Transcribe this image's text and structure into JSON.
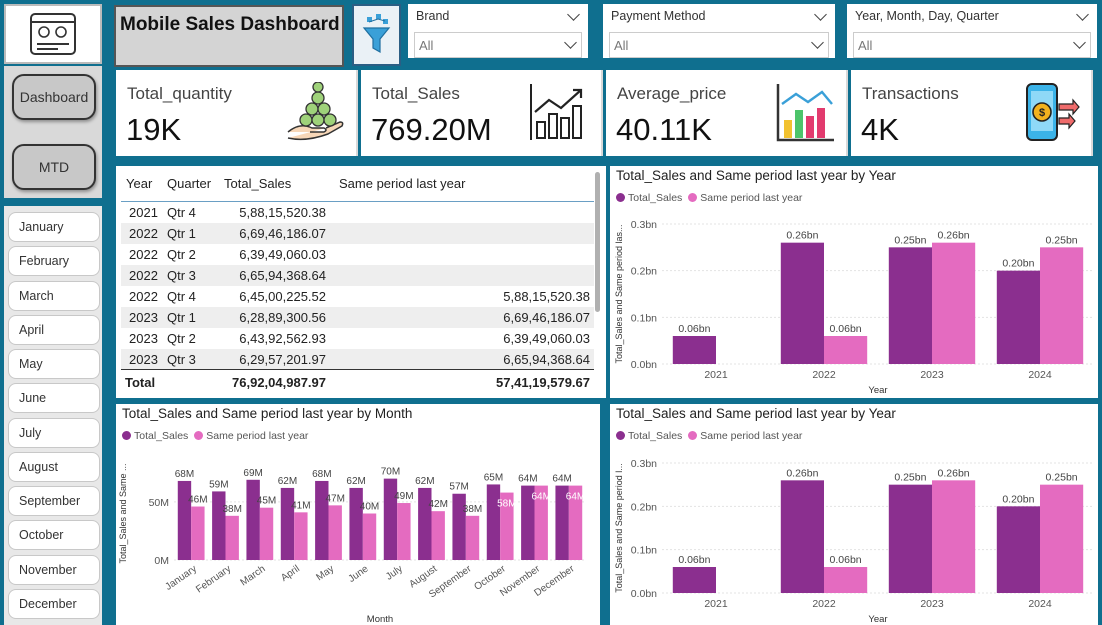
{
  "app": {
    "title": "Mobile Sales Dashboard"
  },
  "nav": {
    "dashboard_label": "Dashboard",
    "mtd_label": "MTD"
  },
  "months": [
    "January",
    "February",
    "March",
    "April",
    "May",
    "June",
    "July",
    "August",
    "September",
    "October",
    "November",
    "December"
  ],
  "filters": {
    "brand": {
      "label": "Brand",
      "value": "All"
    },
    "payment": {
      "label": "Payment Method",
      "value": "All"
    },
    "date": {
      "label": "Year, Month, Day, Quarter",
      "value": "All"
    }
  },
  "kpis": {
    "quantity": {
      "label": "Total_quantity",
      "value": "19K"
    },
    "sales": {
      "label": "Total_Sales",
      "value": "769.20M"
    },
    "avg_price": {
      "label": "Average_price",
      "value": "40.11K"
    },
    "transactions": {
      "label": "Transactions",
      "value": "4K"
    }
  },
  "table": {
    "headers": [
      "Year",
      "Quarter",
      "Total_Sales",
      "Same period last year"
    ],
    "rows": [
      [
        "2021",
        "Qtr 4",
        "5,88,15,520.38",
        ""
      ],
      [
        "2022",
        "Qtr 1",
        "6,69,46,186.07",
        ""
      ],
      [
        "2022",
        "Qtr 2",
        "6,39,49,060.03",
        ""
      ],
      [
        "2022",
        "Qtr 3",
        "6,65,94,368.64",
        ""
      ],
      [
        "2022",
        "Qtr 4",
        "6,45,00,225.52",
        "5,88,15,520.38"
      ],
      [
        "2023",
        "Qtr 1",
        "6,28,89,300.56",
        "6,69,46,186.07"
      ],
      [
        "2023",
        "Qtr 2",
        "6,43,92,562.93",
        "6,39,49,060.03"
      ],
      [
        "2023",
        "Qtr 3",
        "6,29,57,201.97",
        "6,65,94,368.64"
      ]
    ],
    "total": {
      "label": "Total",
      "sales": "76,92,04,987.97",
      "last_year": "57,41,19,579.67"
    }
  },
  "colors": {
    "series1": "#8b2f8f",
    "series2": "#e46bc0",
    "accent": "#0f6f8f"
  },
  "chart_data": [
    {
      "type": "bar",
      "title": "Total_Sales and Same period last year by Year",
      "xlabel": "Year",
      "ylabel": "Total_Sales and Same period las...",
      "categories": [
        "2021",
        "2022",
        "2023",
        "2024"
      ],
      "yticks": [
        "0.0bn",
        "0.1bn",
        "0.2bn",
        "0.3bn"
      ],
      "ylim": [
        0,
        0.3
      ],
      "series": [
        {
          "name": "Total_Sales",
          "values": [
            0.06,
            0.26,
            0.25,
            0.2
          ],
          "labels": [
            "0.06bn",
            "0.26bn",
            "0.25bn",
            "0.20bn"
          ]
        },
        {
          "name": "Same period last year",
          "values": [
            null,
            0.06,
            0.26,
            0.25
          ],
          "labels": [
            "",
            "0.06bn",
            "0.26bn",
            "0.25bn"
          ]
        }
      ]
    },
    {
      "type": "bar",
      "title": "Total_Sales and Same period last year by Month",
      "xlabel": "Month",
      "ylabel": "Total_Sales and Same ...",
      "categories": [
        "January",
        "February",
        "March",
        "April",
        "May",
        "June",
        "July",
        "August",
        "September",
        "October",
        "November",
        "December"
      ],
      "yticks": [
        "0M",
        "50M"
      ],
      "ylim": [
        0,
        80
      ],
      "series": [
        {
          "name": "Total_Sales",
          "values": [
            68,
            59,
            69,
            62,
            68,
            62,
            70,
            62,
            57,
            65,
            64,
            64
          ],
          "labels": [
            "68M",
            "59M",
            "69M",
            "62M",
            "68M",
            "62M",
            "70M",
            "62M",
            "57M",
            "65M",
            "64M",
            "64M"
          ]
        },
        {
          "name": "Same period last year",
          "values": [
            46,
            38,
            45,
            41,
            47,
            40,
            49,
            42,
            38,
            58,
            64,
            64
          ],
          "labels": [
            "46M",
            "38M",
            "45M",
            "41M",
            "47M",
            "40M",
            "49M",
            "42M",
            "38M",
            "58M",
            "64M",
            "64M"
          ]
        }
      ]
    },
    {
      "type": "bar",
      "title": "Total_Sales and Same period last year by Year",
      "xlabel": "Year",
      "ylabel": "Total_Sales and Same period l...",
      "categories": [
        "2021",
        "2022",
        "2023",
        "2024"
      ],
      "yticks": [
        "0.0bn",
        "0.1bn",
        "0.2bn",
        "0.3bn"
      ],
      "ylim": [
        0,
        0.3
      ],
      "series": [
        {
          "name": "Total_Sales",
          "values": [
            0.06,
            0.26,
            0.25,
            0.2
          ],
          "labels": [
            "0.06bn",
            "0.26bn",
            "0.25bn",
            "0.20bn"
          ]
        },
        {
          "name": "Same period last year",
          "values": [
            null,
            0.06,
            0.26,
            0.25
          ],
          "labels": [
            "",
            "0.06bn",
            "0.26bn",
            "0.25bn"
          ]
        }
      ]
    }
  ]
}
